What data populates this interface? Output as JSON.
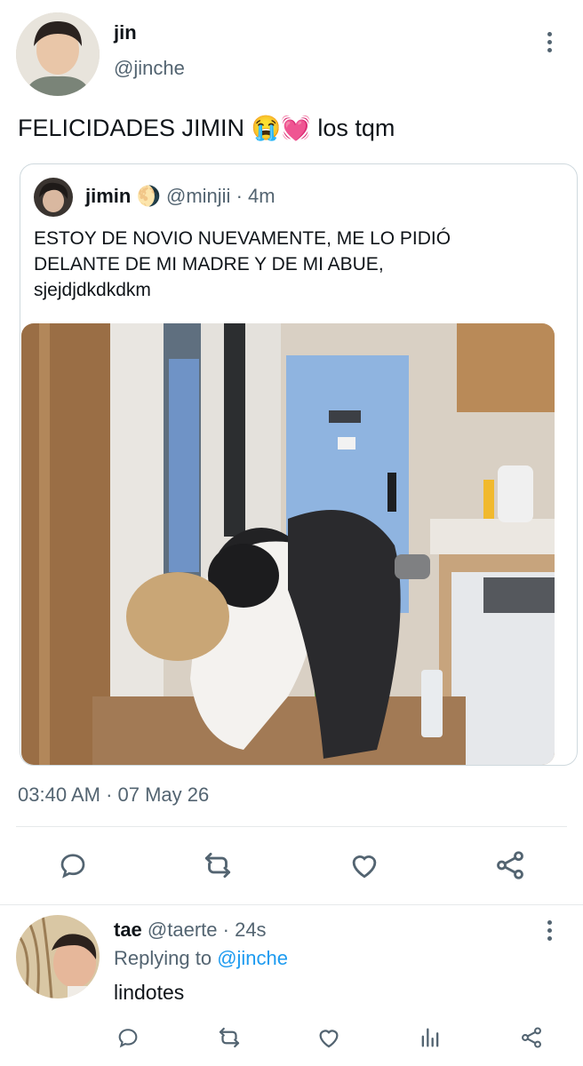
{
  "tweet": {
    "author_name": "jin",
    "author_handle": "@jinche",
    "text": "FELICIDADES JIMIN",
    "emoji_1": "😭",
    "emoji_2": "💓",
    "text_suffix": "los tqm",
    "timestamp": "03:40 AM · 07 May 26"
  },
  "quote": {
    "author_name": "jimin",
    "moon_emoji": "🌖",
    "author_handle": "@minjii",
    "age": "· 4m",
    "line_1": "ESTOY DE NOVIO NUEVAMENTE, ME LO PIDIÓ",
    "line_2": "DELANTE DE MI MADRE Y DE MI ABUE,",
    "line_3": "sjejdjdkdkdkm"
  },
  "reply": {
    "author_name": "tae",
    "author_handle": "@taerte",
    "age": "· 24s",
    "replying_to_label": "Replying to",
    "replying_to_handle": "@jinche",
    "text": "lindotes"
  },
  "colors": {
    "accent": "#1d9bf0",
    "muted": "#536471",
    "text": "#0f1419"
  },
  "icons": [
    "comment-icon",
    "retweet-icon",
    "heart-icon",
    "share-icon",
    "analytics-icon",
    "more-icon"
  ]
}
